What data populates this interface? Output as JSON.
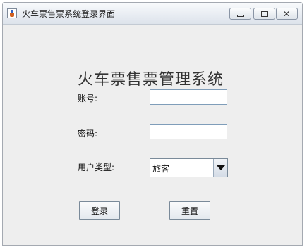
{
  "window": {
    "title": "火车票售票系统登录界面"
  },
  "form": {
    "heading": "火车票售票管理系统",
    "account_label": "账号:",
    "account_value": "",
    "password_label": "密码:",
    "password_value": "",
    "user_type_label": "用户类型:",
    "user_type_selected": "旅客"
  },
  "buttons": {
    "login": "登录",
    "reset": "重置"
  },
  "icons": {
    "app": "java-coffee-cup-icon",
    "minimize": "minimize-icon",
    "maximize": "maximize-icon",
    "close": "close-icon",
    "dropdown": "chevron-down-icon"
  }
}
